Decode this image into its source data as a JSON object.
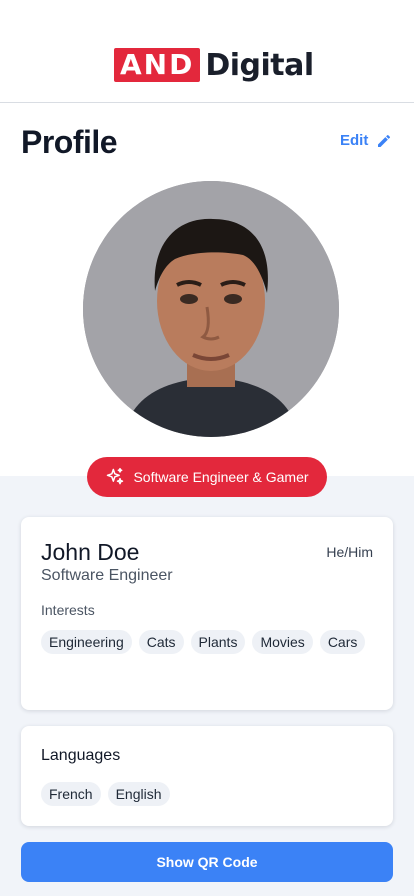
{
  "logo": {
    "mark": "AND",
    "text": "Digital"
  },
  "header": {
    "title": "Profile",
    "edit_label": "Edit"
  },
  "profile": {
    "role_badge": "Software Engineer & Gamer",
    "name": "John Doe",
    "pronouns": "He/Him",
    "job_title": "Software Engineer",
    "interests_label": "Interests",
    "interests": [
      "Engineering",
      "Cats",
      "Plants",
      "Movies",
      "Cars"
    ]
  },
  "languages": {
    "title": "Languages",
    "items": [
      "French",
      "English"
    ]
  },
  "actions": {
    "qr_label": "Show QR Code"
  },
  "colors": {
    "brand_red": "#e3283c",
    "accent_blue": "#3b82f6",
    "background": "#f1f4f9"
  },
  "icons": {
    "edit": "pencil-icon",
    "badge": "sparkles-icon"
  }
}
